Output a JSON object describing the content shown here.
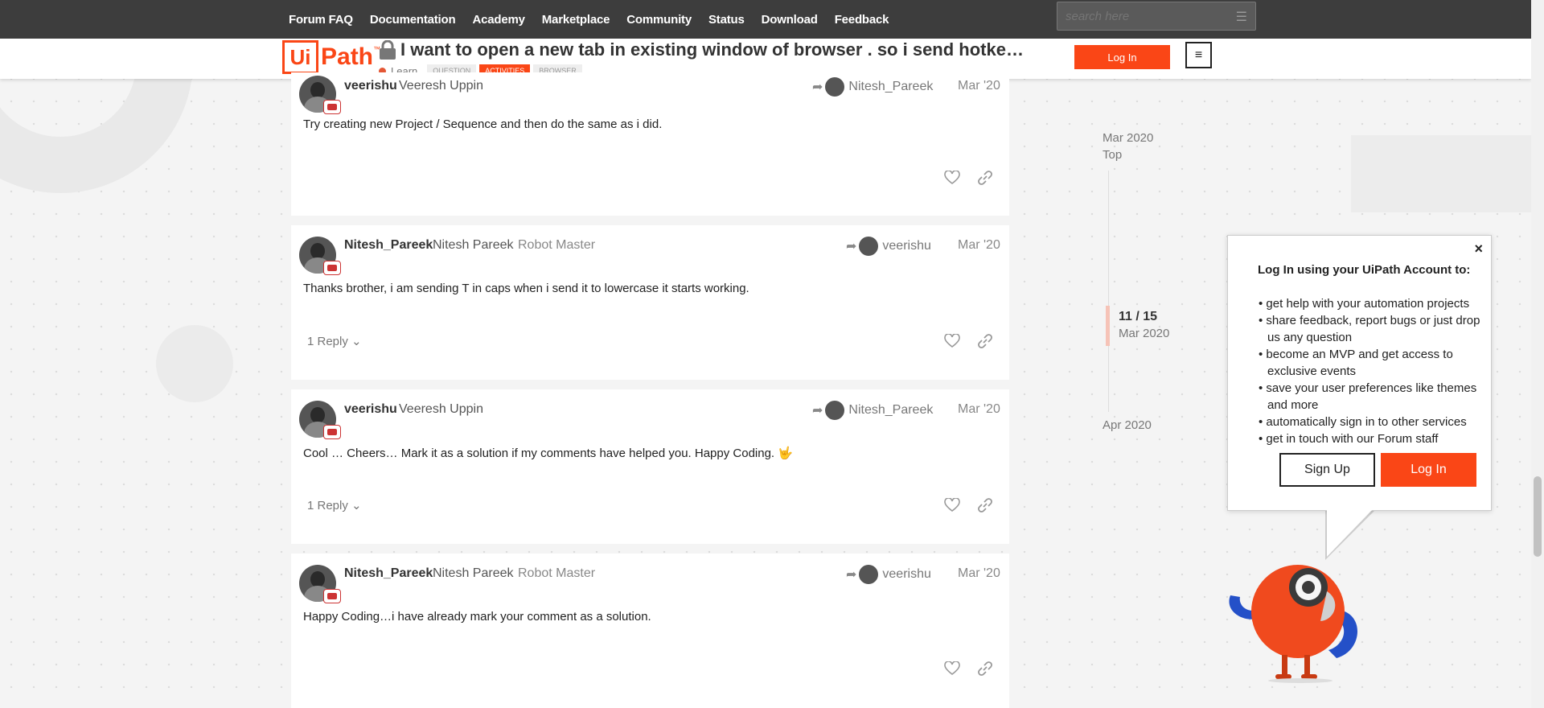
{
  "nav": {
    "links": [
      "Forum FAQ",
      "Documentation",
      "Academy",
      "Marketplace",
      "Community",
      "Status",
      "Download",
      "Feedback"
    ],
    "search_placeholder": "search here"
  },
  "header": {
    "logo_ui": "Ui",
    "logo_path": "Path",
    "logo_tm": "™",
    "topic_title": "I want to open a new tab in existing window of browser . so i send hotke…",
    "category": "Learn",
    "tags": [
      "QUESTION",
      "ACTIVITIES",
      "BROWSER"
    ],
    "login_label": "Log In",
    "menu_icon": "≡"
  },
  "posts": [
    {
      "username": "veerishu",
      "fullname": "Veeresh Uppin",
      "title": "",
      "reply_to": "Nitesh_Pareek",
      "date": "Mar '20",
      "body": "Try creating new Project / Sequence and then do the same as i did.",
      "replies": ""
    },
    {
      "username": "Nitesh_Pareek",
      "fullname": "Nitesh Pareek",
      "title": "Robot Master",
      "reply_to": "veerishu",
      "date": "Mar '20",
      "body": "Thanks brother, i am sending T in caps when i send it to lowercase it starts working.",
      "replies": "1 Reply"
    },
    {
      "username": "veerishu",
      "fullname": "Veeresh Uppin",
      "title": "",
      "reply_to": "Nitesh_Pareek",
      "date": "Mar '20",
      "body": "Cool … Cheers… Mark it as a solution if my comments have helped you. Happy Coding. 🤟",
      "replies": "1 Reply"
    },
    {
      "username": "Nitesh_Pareek",
      "fullname": "Nitesh Pareek",
      "title": "Robot Master",
      "reply_to": "veerishu",
      "date": "Mar '20",
      "body": "Happy Coding…i have already mark your comment as a solution.",
      "replies": ""
    }
  ],
  "timeline": {
    "start_date": "Mar 2020",
    "top_label": "Top",
    "position": "11 / 15",
    "position_date": "Mar 2020",
    "end_date": "Apr 2020"
  },
  "popup": {
    "heading": "Log In using your UiPath Account to:",
    "items": [
      "get help with your automation projects",
      "share feedback, report bugs or just drop us any question",
      "become an MVP and get access to exclusive events",
      "save your user preferences like themes and more",
      "automatically sign in to other services",
      "get in touch with our Forum staff"
    ],
    "signup_label": "Sign Up",
    "login_label": "Log In",
    "close_icon": "×"
  },
  "colors": {
    "brand": "#fa4616",
    "topnav": "#3d3d3d"
  }
}
